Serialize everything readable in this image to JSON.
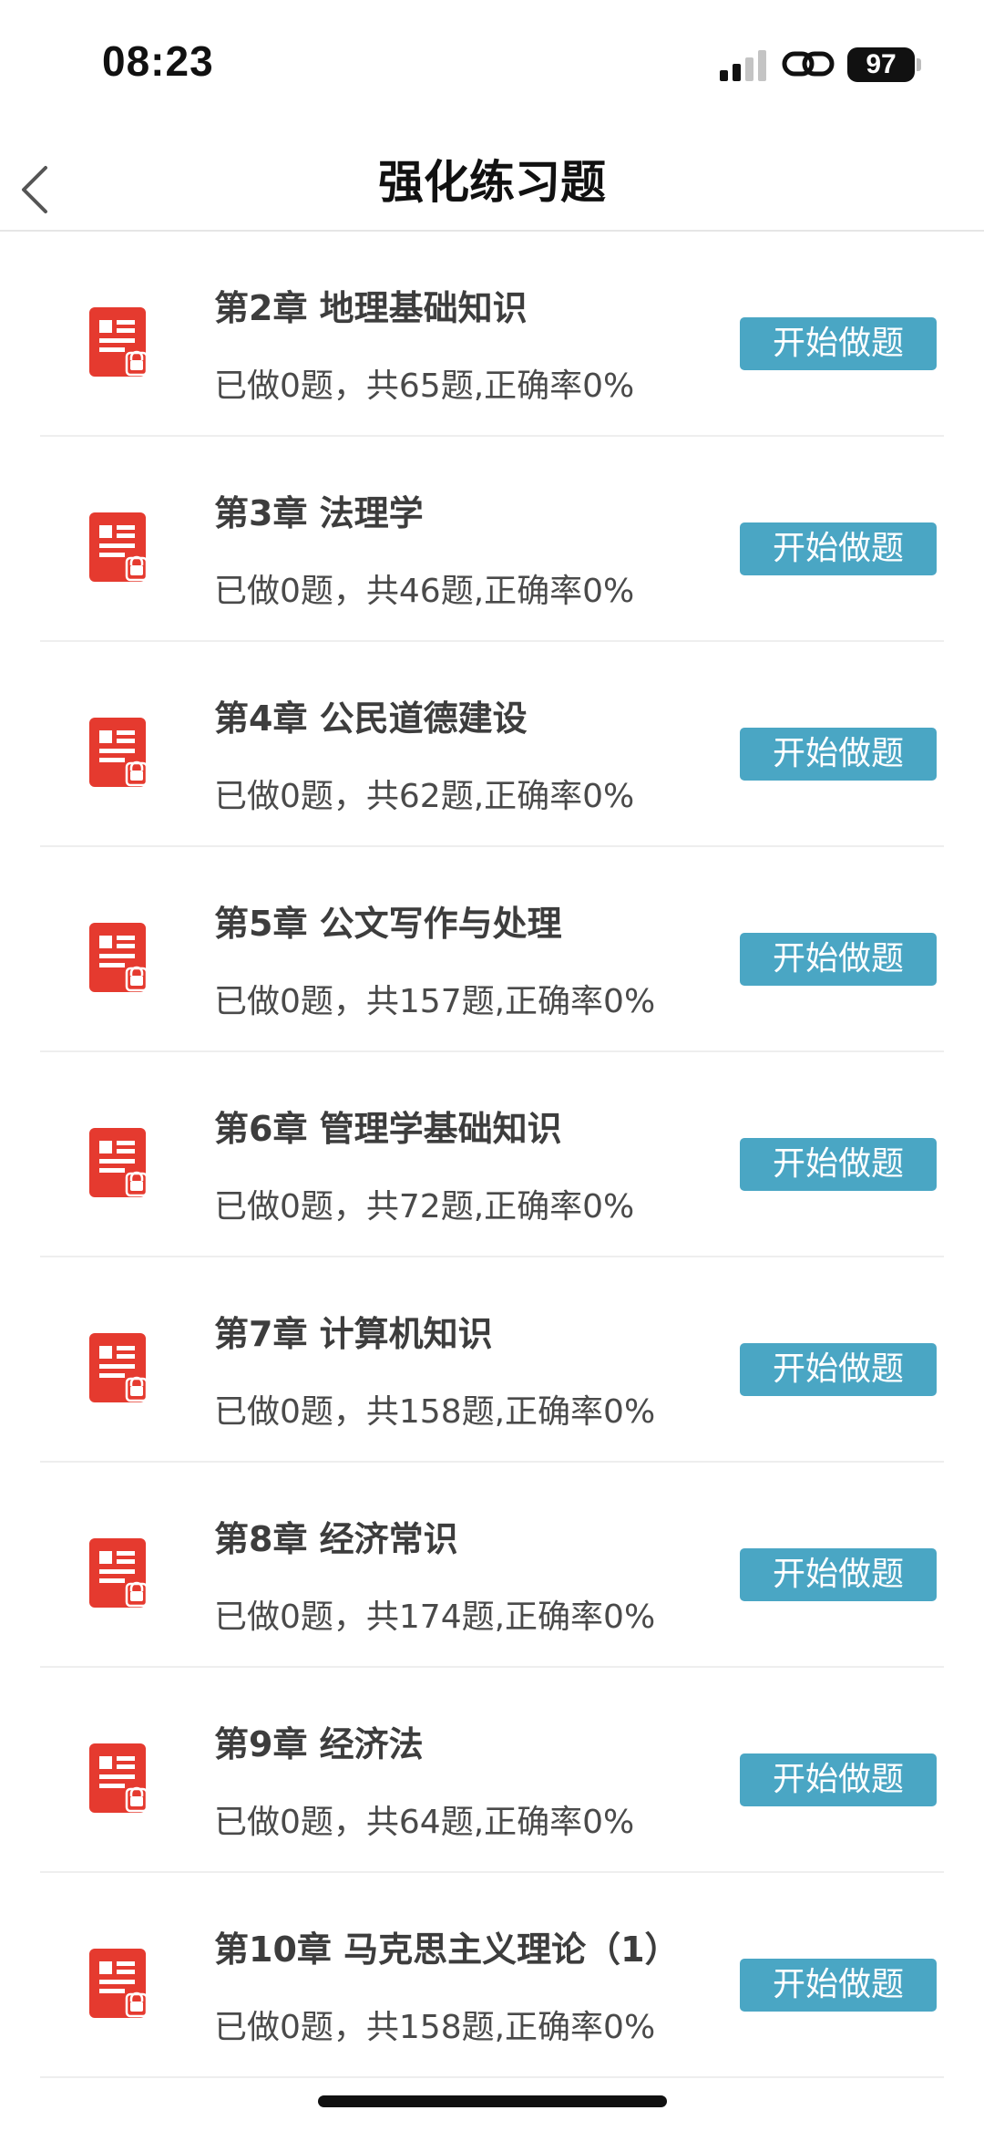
{
  "status_bar": {
    "time": "08:23",
    "battery": "97",
    "icons": [
      "signal-icon",
      "link-icon",
      "battery-icon"
    ]
  },
  "header": {
    "title": "强化练习题",
    "back_icon": "chevron-left-icon"
  },
  "colors": {
    "accent": "#4aa6c4",
    "icon_red": "#e53a2f",
    "divider": "#eeeeee"
  },
  "chapters": [
    {
      "title": "第2章  地理基础知识",
      "progress": "已做0题，共65题,正确率0%",
      "button": "开始做题"
    },
    {
      "title": "第3章  法理学",
      "progress": "已做0题，共46题,正确率0%",
      "button": "开始做题"
    },
    {
      "title": "第4章  公民道德建设",
      "progress": "已做0题，共62题,正确率0%",
      "button": "开始做题"
    },
    {
      "title": "第5章  公文写作与处理",
      "progress": "已做0题，共157题,正确率0%",
      "button": "开始做题"
    },
    {
      "title": "第6章  管理学基础知识",
      "progress": "已做0题，共72题,正确率0%",
      "button": "开始做题"
    },
    {
      "title": "第7章  计算机知识",
      "progress": "已做0题，共158题,正确率0%",
      "button": "开始做题"
    },
    {
      "title": "第8章  经济常识",
      "progress": "已做0题，共174题,正确率0%",
      "button": "开始做题"
    },
    {
      "title": "第9章  经济法",
      "progress": "已做0题，共64题,正确率0%",
      "button": "开始做题"
    },
    {
      "title": "第10章  马克思主义理论（1）",
      "progress": "已做0题，共158题,正确率0%",
      "button": "开始做题"
    }
  ]
}
